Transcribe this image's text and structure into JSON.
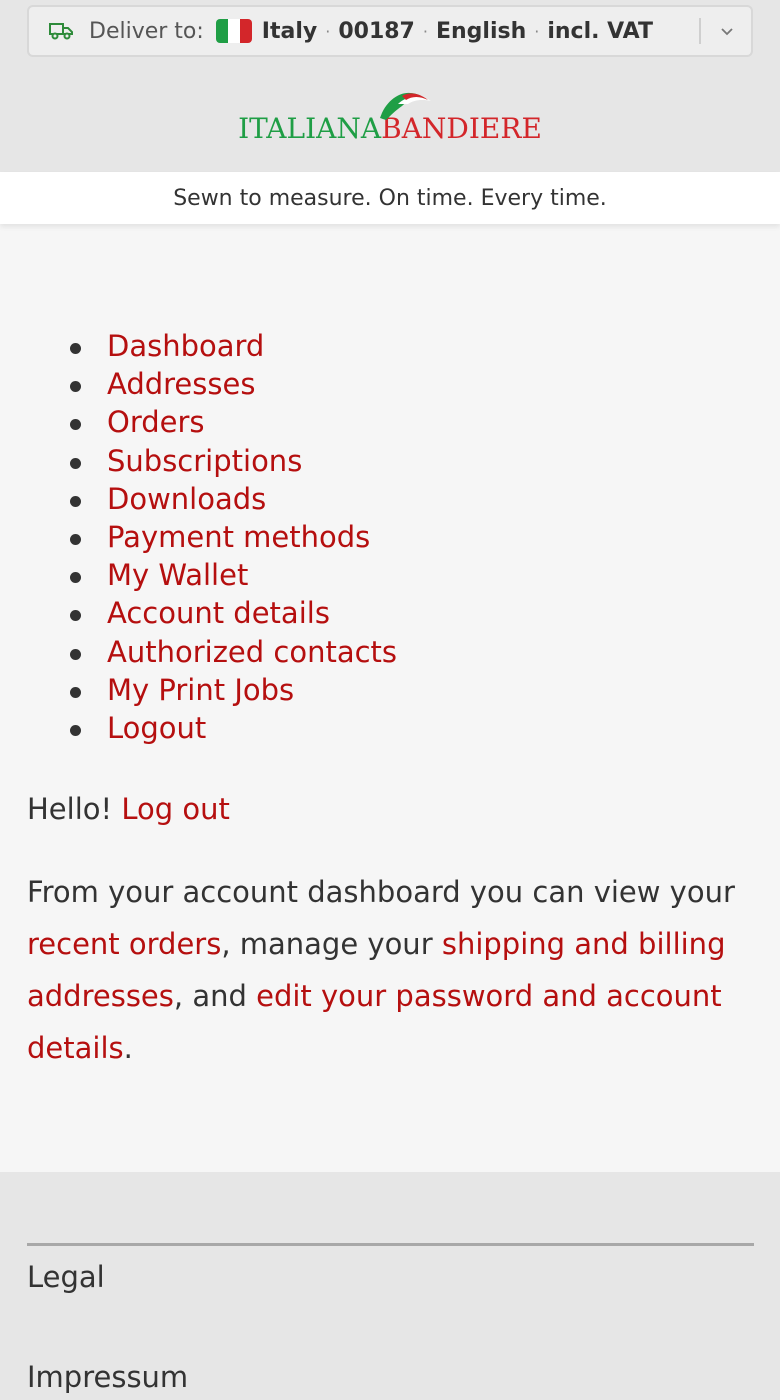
{
  "delivery": {
    "label": "Deliver to:",
    "country": "Italy",
    "postcode": "00187",
    "language": "English",
    "tax": "incl. VAT",
    "flag_colors": [
      "#1f9e45",
      "#ffffff",
      "#d3262a"
    ]
  },
  "brand": {
    "part1": "ITALIANA",
    "part2": "BANDIERE",
    "green": "#1f9e45",
    "red": "#d3262a"
  },
  "tagline": "Sewn to measure. On time. Every time.",
  "nav": {
    "items": [
      {
        "label": "Dashboard"
      },
      {
        "label": "Addresses"
      },
      {
        "label": "Orders"
      },
      {
        "label": "Subscriptions"
      },
      {
        "label": "Downloads"
      },
      {
        "label": "Payment methods"
      },
      {
        "label": "My Wallet"
      },
      {
        "label": "Account details"
      },
      {
        "label": "Authorized contacts"
      },
      {
        "label": "My Print Jobs"
      },
      {
        "label": "Logout"
      }
    ]
  },
  "greeting": {
    "text": "Hello!",
    "logout_link": "Log out"
  },
  "intro": {
    "t1": "From your account dashboard you can view your ",
    "link1": "recent orders",
    "t2": ", manage your ",
    "link2": "shipping and billing addresses",
    "t3": ", and ",
    "link3": "edit your password and account details",
    "t4": "."
  },
  "footer": {
    "legal": "Legal",
    "impressum": "Impressum"
  },
  "colors": {
    "link": "#b50f0f",
    "background": "#f6f6f6",
    "header_bg": "#e6e6e6"
  }
}
